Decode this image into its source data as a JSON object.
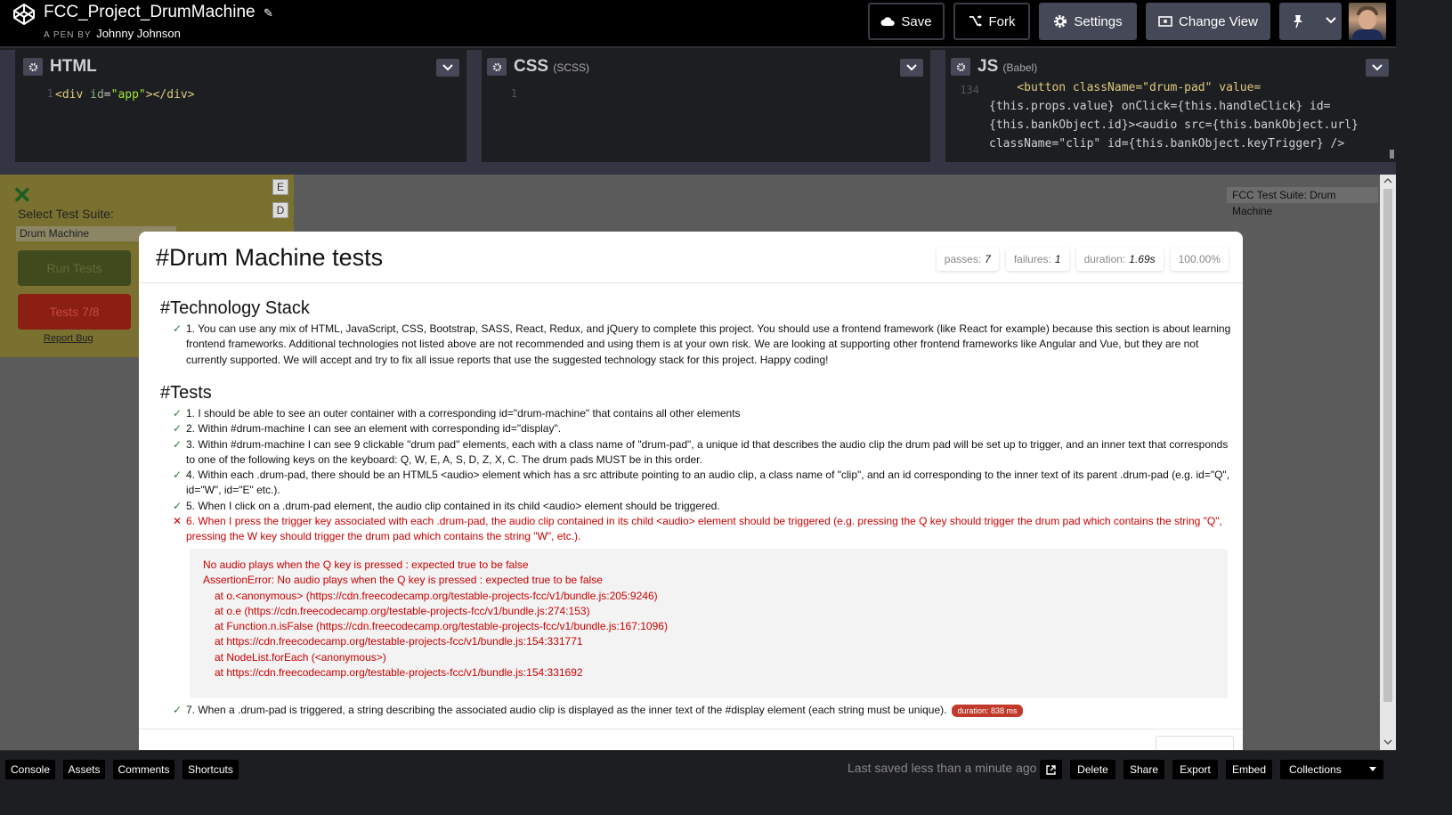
{
  "header": {
    "pen_title": "FCC_Project_DrumMachine",
    "byline_prefix": "A PEN BY",
    "author": "Johnny Johnson",
    "buttons": {
      "save": "Save",
      "fork": "Fork",
      "settings": "Settings",
      "change_view": "Change View"
    }
  },
  "editors": {
    "html": {
      "label": "HTML",
      "line_number": "1",
      "code": "<div id=\"app\"></div>"
    },
    "css": {
      "label": "CSS",
      "preprocessor": "(SCSS)",
      "line_number": "1"
    },
    "js": {
      "label": "JS",
      "preprocessor": "(Babel)",
      "line_number": "134",
      "lines": [
        "    <button className=\"drum-pad\" value=",
        "{this.props.value} onClick={this.handleClick} id=",
        "{this.bankObject.id}><audio src={this.bankObject.url}",
        "className=\"clip\" id={this.bankObject.keyTrigger} />"
      ]
    }
  },
  "test_panel": {
    "select_label": "Select Test Suite:",
    "selected_suite": "Drum Machine",
    "run_button": "Run Tests",
    "tests_button": "Tests 7/8",
    "report_bug": "Report Bug",
    "badge": "FCC Test Suite: Drum Machine",
    "pad_letters": [
      "E",
      "D"
    ]
  },
  "mocha": {
    "title": "#Drum Machine tests",
    "stats": {
      "passes_label": "passes:",
      "passes": "7",
      "failures_label": "failures:",
      "failures": "1",
      "duration_label": "duration:",
      "duration": "1.69s",
      "percent": "100.00%"
    },
    "tech_heading": "#Technology Stack",
    "tech_item": "1. You can use any mix of HTML, JavaScript, CSS, Bootstrap, SASS, React, Redux, and jQuery to complete this project. You should use a frontend framework (like React for example) because this section is about learning frontend frameworks. Additional technologies not listed above are not recommended and using them is at your own risk. We are looking at supporting other frontend frameworks like Angular and Vue, but they are not currently supported. We will accept and try to fix all issue reports that use the suggested technology stack for this project. Happy coding!",
    "tests_heading": "#Tests",
    "tests": [
      {
        "text": "1. I should be able to see an outer container with a corresponding id=\"drum-machine\" that contains all other elements",
        "status": "pass"
      },
      {
        "text": "2. Within #drum-machine I can see an element with corresponding id=\"display\".",
        "status": "pass"
      },
      {
        "text": "3. Within #drum-machine I can see 9 clickable \"drum pad\" elements, each with a class name of \"drum-pad\", a unique id that describes the audio clip the drum pad will be set up to trigger, and an inner text that corresponds to one of the following keys on the keyboard: Q, W, E, A, S, D, Z, X, C. The drum pads MUST be in this order.",
        "status": "pass"
      },
      {
        "text": "4. Within each .drum-pad, there should be an HTML5 <audio> element which has a src attribute pointing to an audio clip, a class name of \"clip\", and an id corresponding to the inner text of its parent .drum-pad (e.g. id=\"Q\", id=\"W\", id=\"E\" etc.).",
        "status": "pass"
      },
      {
        "text": "5. When I click on a .drum-pad element, the audio clip contained in its child <audio> element should be triggered.",
        "status": "pass"
      },
      {
        "text": "6. When I press the trigger key associated with each .drum-pad, the audio clip contained in its child <audio> element should be triggered (e.g. pressing the Q key should trigger the drum pad which contains the string \"Q\", pressing the W key should trigger the drum pad which contains the string \"W\", etc.).",
        "status": "fail"
      },
      {
        "text": "7. When a .drum-pad is triggered, a string describing the associated audio clip is displayed as the inner text of the #display element (each string must be unique).",
        "status": "pass"
      }
    ],
    "error_lines": [
      "No audio plays when the Q key is pressed : expected true to be false",
      "AssertionError: No audio plays when the Q key is pressed : expected true to be false",
      "at o.<anonymous> (https://cdn.freecodecamp.org/testable-projects-fcc/v1/bundle.js:205:9246)",
      "at o.e (https://cdn.freecodecamp.org/testable-projects-fcc/v1/bundle.js:274:153)",
      "at Function.n.isFalse (https://cdn.freecodecamp.org/testable-projects-fcc/v1/bundle.js:167:1096)",
      "at https://cdn.freecodecamp.org/testable-projects-fcc/v1/bundle.js:154:331771",
      "at NodeList.forEach (<anonymous>)",
      "at https://cdn.freecodecamp.org/testable-projects-fcc/v1/bundle.js:154:331692"
    ],
    "test7_duration": "duration:  838 ms"
  },
  "footer": {
    "console": "Console",
    "assets": "Assets",
    "comments": "Comments",
    "shortcuts": "Shortcuts",
    "last_saved": "Last saved less than a minute ago",
    "delete": "Delete",
    "share": "Share",
    "export": "Export",
    "embed": "Embed",
    "collections": "Collections"
  }
}
